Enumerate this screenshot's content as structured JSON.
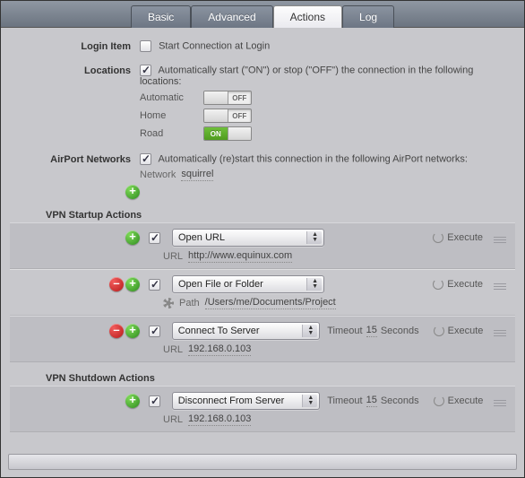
{
  "tabs": {
    "basic": "Basic",
    "advanced": "Advanced",
    "actions": "Actions",
    "log": "Log"
  },
  "login_item": {
    "label": "Login Item",
    "checkbox_label": "Start Connection at Login",
    "checked": false
  },
  "locations": {
    "label": "Locations",
    "checkbox_label": "Automatically start (\"ON\") or stop (\"OFF\") the connection in the following locations:",
    "checked": true,
    "items": [
      {
        "name": "Automatic",
        "state": "OFF"
      },
      {
        "name": "Home",
        "state": "OFF"
      },
      {
        "name": "Road",
        "state": "ON"
      }
    ]
  },
  "airport": {
    "label": "AirPort Networks",
    "checkbox_label": "Automatically (re)start this connection in the following AirPort networks:",
    "checked": true,
    "network_label": "Network",
    "network_value": "squirrel"
  },
  "startup_header": "VPN Startup Actions",
  "shutdown_header": "VPN Shutdown Actions",
  "execute_label": "Execute",
  "timeout_label": "Timeout",
  "seconds_label": "Seconds",
  "startup_actions": [
    {
      "checked": true,
      "type": "Open URL",
      "sub_label": "URL",
      "sub_value": "http://www.equinux.com",
      "remove": false,
      "timeout": null
    },
    {
      "checked": true,
      "type": "Open File or Folder",
      "sub_label": "Path",
      "sub_value": "/Users/me/Documents/Project",
      "remove": true,
      "timeout": null,
      "path_gear": true
    },
    {
      "checked": true,
      "type": "Connect To Server",
      "sub_label": "URL",
      "sub_value": "192.168.0.103",
      "remove": true,
      "timeout": "15"
    }
  ],
  "shutdown_actions": [
    {
      "checked": true,
      "type": "Disconnect From Server",
      "sub_label": "URL",
      "sub_value": "192.168.0.103",
      "remove": false,
      "timeout": "15"
    }
  ]
}
